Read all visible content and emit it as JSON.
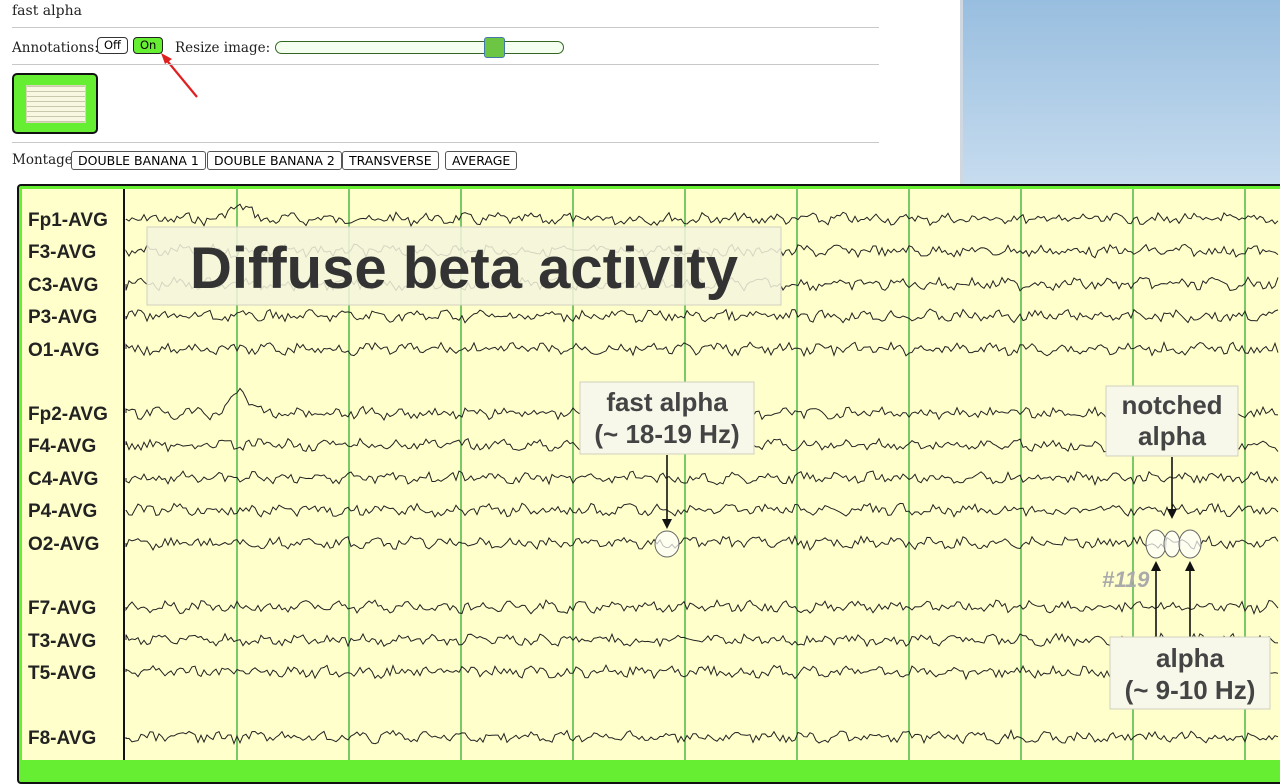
{
  "page": {
    "title": "fast alpha"
  },
  "annotations": {
    "label": "Annotations:",
    "off_label": "Off",
    "on_label": "On",
    "selected": "On"
  },
  "resize": {
    "label": "Resize image:",
    "value_fraction": 0.76
  },
  "montage": {
    "label": "Montage:",
    "options": [
      "DOUBLE BANANA 1",
      "DOUBLE BANANA 2",
      "TRANSVERSE",
      "AVERAGE"
    ]
  },
  "eeg": {
    "channels": [
      "Fp1-AVG",
      "F3-AVG",
      "C3-AVG",
      "P3-AVG",
      "O1-AVG",
      "Fp2-AVG",
      "F4-AVG",
      "C4-AVG",
      "P4-AVG",
      "O2-AVG",
      "F7-AVG",
      "T3-AVG",
      "T5-AVG",
      "F8-AVG"
    ],
    "title_annotation": "Diffuse beta activity",
    "fast_alpha": {
      "line1": "fast alpha",
      "line2": "(~ 18-19 Hz)"
    },
    "notched_alpha": {
      "line1": "notched",
      "line2": "alpha"
    },
    "alpha": {
      "line1": "alpha",
      "line2": "(~ 9-10 Hz)"
    },
    "figure_number": "#119",
    "colors": {
      "background": "#ffffcc",
      "grid": "#33aa33",
      "trace": "#222222",
      "frame": "#66ee33"
    }
  }
}
